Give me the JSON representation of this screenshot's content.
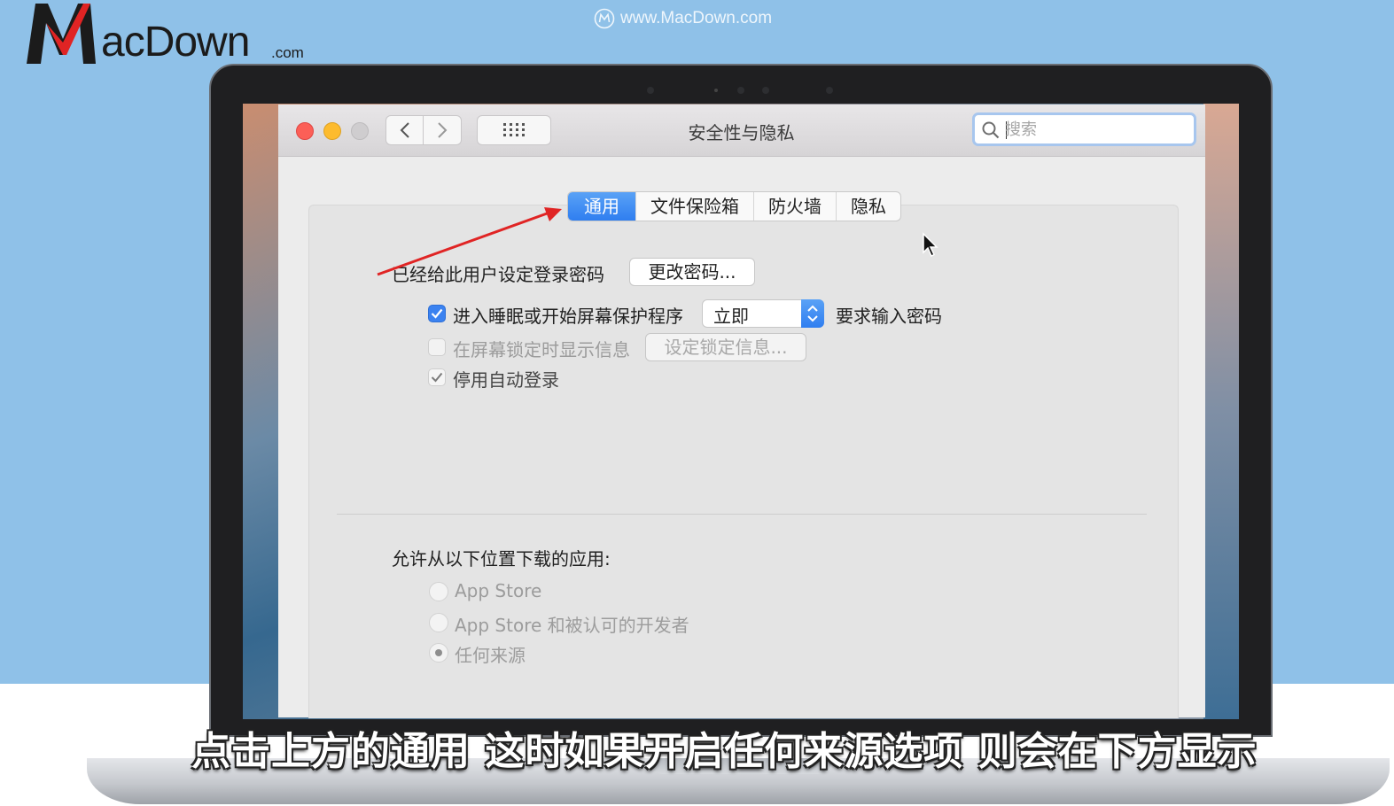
{
  "brand": {
    "logo_main": "acDown",
    "logo_suffix": ".com",
    "watermark": "www.MacDown.com"
  },
  "window": {
    "title": "安全性与隐私",
    "search": {
      "placeholder": "搜索",
      "value": ""
    }
  },
  "tabs": [
    {
      "label": "通用",
      "active": true
    },
    {
      "label": "文件保险箱",
      "active": false
    },
    {
      "label": "防火墙",
      "active": false
    },
    {
      "label": "隐私",
      "active": false
    }
  ],
  "general": {
    "password_set_label": "已经给此用户设定登录密码",
    "change_password_button": "更改密码...",
    "require_password": {
      "checked": true,
      "label": "进入睡眠或开始屏幕保护程序",
      "select_value": "立即",
      "suffix": "要求输入密码"
    },
    "lock_message": {
      "checked": false,
      "label": "在屏幕锁定时显示信息",
      "button": "设定锁定信息..."
    },
    "disable_autologin": {
      "checked": true,
      "label": "停用自动登录"
    }
  },
  "downloads": {
    "heading": "允许从以下位置下载的应用:",
    "options": [
      {
        "label": "App Store",
        "selected": false
      },
      {
        "label": "App Store 和被认可的开发者",
        "selected": false
      },
      {
        "label": "任何来源",
        "selected": true
      }
    ]
  },
  "caption": "点击上方的通用 这时如果开启任何来源选项 则会在下方显示",
  "colors": {
    "accent": "#3b82f0",
    "background": "#8fc1e8",
    "annotation_arrow": "#e02424",
    "close": "#fc5f57",
    "minimize": "#fdbb2e"
  }
}
